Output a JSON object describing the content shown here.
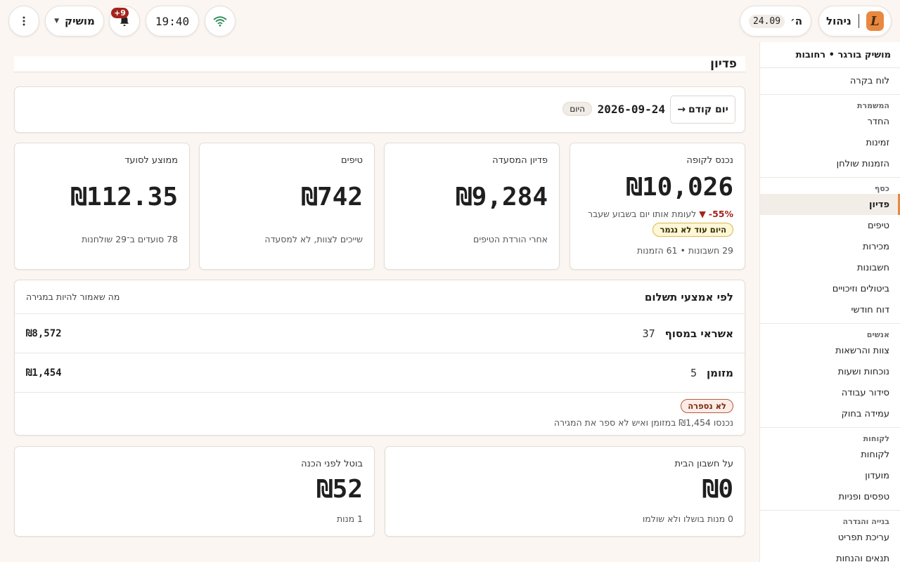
{
  "topbar": {
    "app_label": "ניהול",
    "logo_letter": "L",
    "date_day": "ה׳",
    "date_value": "24.09",
    "user_label": "מושיק",
    "notification_count": "+9",
    "time": "19:40"
  },
  "sidebar": {
    "restaurant": "מושיק בורגר • רחובות",
    "top_item": "לוח בקרה",
    "sections": [
      {
        "title": "המשמרת",
        "items": [
          "החדר",
          "זמינות",
          "הזמנות שולחן"
        ]
      },
      {
        "title": "כסף",
        "items": [
          "פדיון",
          "טיפים",
          "מכירות",
          "חשבונות",
          "ביטולים וזיכויים",
          "דוח חודשי"
        ]
      },
      {
        "title": "אנשים",
        "items": [
          "צוות והרשאות",
          "נוכחות ושעות",
          "סידור עבודה",
          "עמידה בחוק"
        ]
      },
      {
        "title": "לקוחות",
        "items": [
          "לקוחות",
          "מועדון",
          "טפסים ופניות"
        ]
      },
      {
        "title": "בנייה והגדרה",
        "items": [
          "עריכת תפריט",
          "תנאים והנחות"
        ]
      }
    ],
    "active": "פדיון"
  },
  "main": {
    "title": "פדיון",
    "datebar": {
      "prev_label": "יום קודם",
      "prev_arrow": "→",
      "date": "2026-09-24",
      "today_chip": "היום"
    },
    "stats": {
      "register": {
        "label": "נכנס לקופה",
        "value": "₪10,026",
        "trend_pct": "-55%",
        "trend_arrow": "▼",
        "trend_text": "לעומת אותו יום בשבוע שעבר",
        "chip": "היום עוד לא נגמר",
        "counts": "29 חשבונות • 61 הזמנות"
      },
      "revenue": {
        "label": "פדיון המסעדה",
        "value": "₪9,284",
        "sub": "אחרי הורדת הטיפים"
      },
      "tips": {
        "label": "טיפים",
        "value": "₪742",
        "sub": "שייכים לצוות, לא למסעדה"
      },
      "avg": {
        "label": "ממוצע לסועד",
        "value": "₪112.35",
        "sub": "78 סועדים ב־29 שולחנות"
      }
    },
    "payments": {
      "title": "לפי אמצעי תשלום",
      "subtitle": "מה שאמור להיות במגירה",
      "rows": [
        {
          "name": "אשראי במסוף",
          "count": "37",
          "amount": "₪8,572"
        },
        {
          "name": "מזומן",
          "count": "5",
          "amount": "₪1,454"
        }
      ],
      "chip": "לא נספרה",
      "note": "נכנסו ₪1,454 במזומן ואיש לא ספר את המגירה"
    },
    "bottom": {
      "house": {
        "label": "על חשבון הבית",
        "value": "₪0",
        "sub": "0 מנות בושלו ולא שולמו"
      },
      "cancelled": {
        "label": "בוטל לפני הכנה",
        "value": "₪52",
        "sub": "1 מנות"
      }
    }
  },
  "colors": {
    "accent": "#e8893f",
    "negative": "#a3241c",
    "warning_bg": "#fff7d6",
    "background": "#fbf6f1"
  },
  "icons": [
    "more-vertical-icon",
    "chevron-down-icon",
    "bell-icon",
    "wifi-icon",
    "arrow-right-icon"
  ]
}
